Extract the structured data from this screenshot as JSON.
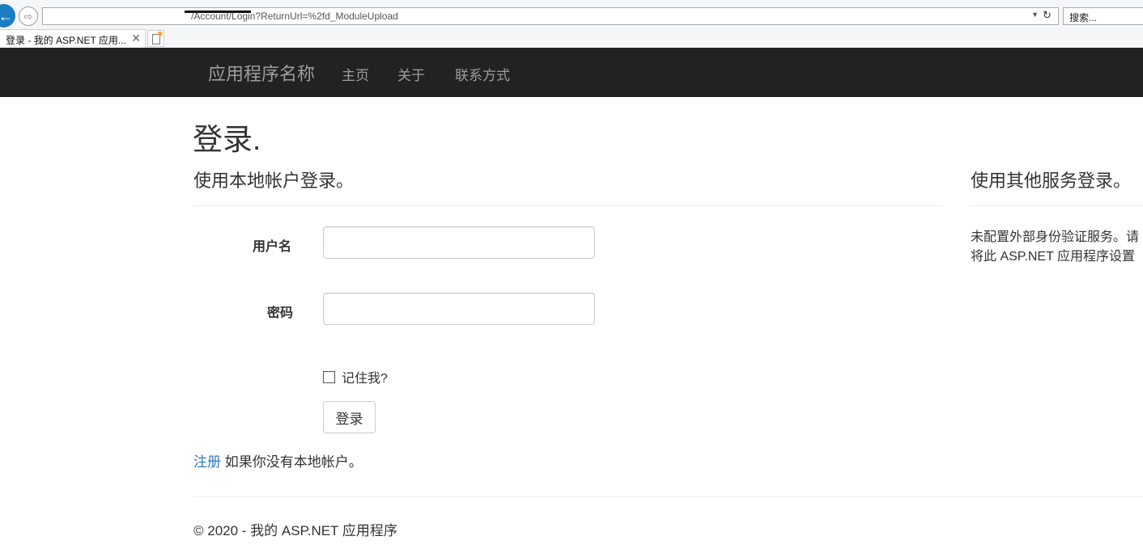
{
  "browser": {
    "address_url": "/Account/Login?ReturnUrl=%2fd_ModuleUpload",
    "search_placeholder": "搜索...",
    "tab_title": "登录 - 我的 ASP.NET 应用...",
    "back_icon": "arrow-left-icon",
    "forward_icon": "arrow-right-icon",
    "refresh_icon": "refresh-icon",
    "accent_color": "#1b7dc2"
  },
  "navbar": {
    "brand": "应用程序名称",
    "links": [
      "主页",
      "关于",
      "联系方式"
    ],
    "background": "#222222",
    "link_color": "#9d9d9d"
  },
  "main": {
    "title": "登录.",
    "local_heading": "使用本地帐户登录。",
    "username_label": "用户名",
    "username_value": "",
    "password_label": "密码",
    "password_value": "",
    "remember_label": "记住我?",
    "remember_checked": false,
    "submit_label": "登录",
    "register_link": "注册",
    "register_text": " 如果你没有本地帐户。",
    "link_color": "#337ab7"
  },
  "external": {
    "heading": "使用其他服务登录。",
    "message_line1": "未配置外部身份验证服务。请",
    "message_line2": "将此 ASP.NET 应用程序设置"
  },
  "footer": {
    "text": "© 2020 - 我的 ASP.NET 应用程序"
  }
}
